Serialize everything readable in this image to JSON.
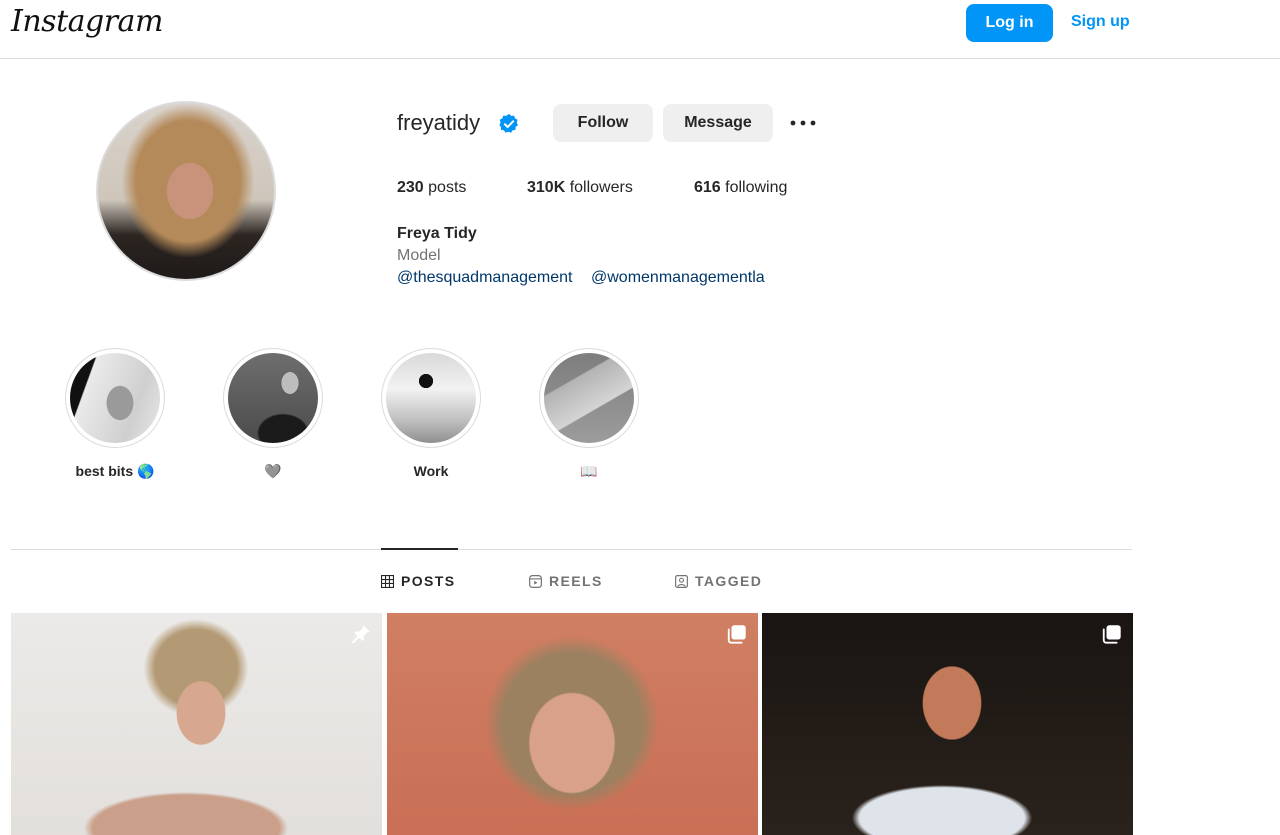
{
  "header": {
    "logo": "Instagram",
    "login_label": "Log in",
    "signup_label": "Sign up",
    "accent_color": "#0095f6"
  },
  "profile": {
    "username": "freyatidy",
    "verified": true,
    "follow_label": "Follow",
    "message_label": "Message",
    "more_icon": "more-horizontal-icon",
    "stats": {
      "posts_count": "230",
      "posts_label": " posts",
      "followers_count": "310K",
      "followers_label": " followers",
      "following_count": "616",
      "following_label": " following"
    },
    "full_name": "Freya Tidy",
    "category": "Model",
    "bio_links": [
      "@thesquadmanagement",
      "@womenmanagementla"
    ]
  },
  "highlights": [
    {
      "label": "best bits 🌎"
    },
    {
      "label": "🩶"
    },
    {
      "label": "Work"
    },
    {
      "label": "📖"
    }
  ],
  "tabs": [
    {
      "label": "POSTS",
      "icon": "grid-icon",
      "active": true
    },
    {
      "label": "REELS",
      "icon": "reels-icon",
      "active": false
    },
    {
      "label": "TAGGED",
      "icon": "tagged-icon",
      "active": false
    }
  ],
  "posts": [
    {
      "badge": "pin-icon"
    },
    {
      "badge": "carousel-icon"
    },
    {
      "badge": "carousel-icon"
    }
  ]
}
